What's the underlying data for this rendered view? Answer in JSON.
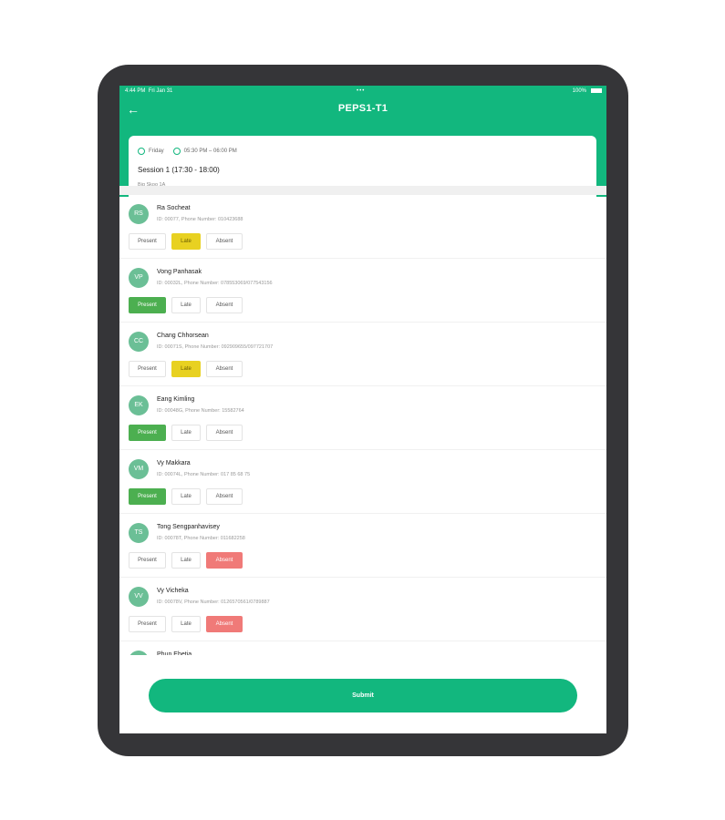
{
  "status_bar": {
    "time": "4:44 PM",
    "date": "Fri Jan 31",
    "dots": "•••",
    "battery": "100%"
  },
  "header": {
    "title": "PEPS1-T1"
  },
  "session": {
    "day": "Friday",
    "time_range": "05:30 PM – 06:00 PM",
    "name": "Session 1 (17:30 - 18:00)",
    "room": "Big Skoo 1A"
  },
  "labels": {
    "present": "Present",
    "late": "Late",
    "absent": "Absent"
  },
  "students": [
    {
      "initials": "RS",
      "name": "Ra Socheat",
      "info": "ID: 00077,   Phone Number: 010423688",
      "status": "late"
    },
    {
      "initials": "VP",
      "name": "Vong Panhasak",
      "info": "ID: 00032L,   Phone Number: 078553069/077543156",
      "status": "present"
    },
    {
      "initials": "CC",
      "name": "Chang Chhorsean",
      "info": "ID: 00071S,   Phone Number: 092909655/097721707",
      "status": "late"
    },
    {
      "initials": "EK",
      "name": "Eang Kimling",
      "info": "ID: 00048G,   Phone Number: 15582764",
      "status": "present"
    },
    {
      "initials": "VM",
      "name": "Vy Makkara",
      "info": "ID: 00074L,   Phone Number: 017 85 68 75",
      "status": "present"
    },
    {
      "initials": "TS",
      "name": "Tong Sengpanhavisey",
      "info": "ID: 00078T,   Phone Number: 011682258",
      "status": "absent"
    },
    {
      "initials": "VV",
      "name": "Vy Vicheka",
      "info": "ID: 00078V,   Phone Number: 0126570561/0789887",
      "status": "absent"
    },
    {
      "initials": "PE",
      "name": "Phun Ehetia",
      "info": "",
      "status": ""
    }
  ],
  "submit_label": "Submit",
  "colors": {
    "brand": "#12b77e",
    "present": "#4caf50",
    "late": "#e8d121",
    "absent": "#f07a78"
  }
}
